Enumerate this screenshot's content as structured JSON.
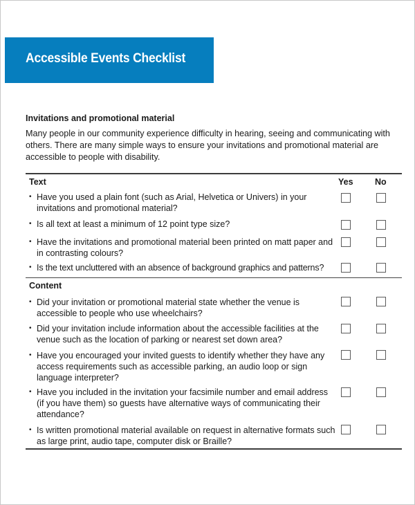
{
  "banner": {
    "title": "Accessible Events Checklist",
    "color": "#067ebe"
  },
  "section": {
    "heading": "Invitations and promotional material",
    "intro": "Many people in our community experience difficulty in hearing, seeing and communicating with others.  There are many simple ways to ensure your invitations and promotional material are accessible to people with disability."
  },
  "table": {
    "columns": {
      "yes": "Yes",
      "no": "No"
    },
    "bullet": "•",
    "groups": [
      {
        "title": "Text",
        "items": [
          {
            "text": "Have you used a plain font (such as Arial, Helvetica or Univers) in your invitations and promotional material?",
            "yes": false,
            "no": false
          },
          {
            "text": "Is all text at least a minimum of 12 point type size?",
            "yes": false,
            "no": false
          },
          {
            "text": "Have the invitations and promotional material been printed on matt paper and in contrasting colours?",
            "yes": false,
            "no": false
          },
          {
            "text": "Is the text uncluttered with an absence of background graphics and patterns?",
            "yes": false,
            "no": false
          }
        ]
      },
      {
        "title": "Content",
        "items": [
          {
            "text": "Did your invitation or promotional material state whether the venue is accessible to people who use wheelchairs?",
            "yes": false,
            "no": false
          },
          {
            "text": "Did your invitation include information about the accessible facilities at the venue such as the location of parking or nearest set down area?",
            "yes": false,
            "no": false
          },
          {
            "text": "Have you encouraged your invited guests to identify whether they have any access requirements such as accessible parking, an audio loop or sign language interpreter?",
            "yes": false,
            "no": false
          },
          {
            "text": "Have you included in the invitation your facsimile number and email address (if you have them) so guests have alternative ways of communicating their attendance?",
            "yes": false,
            "no": false
          },
          {
            "text": "Is written promotional material available on request in alternative formats such as large print, audio tape, computer disk or Braille?",
            "yes": false,
            "no": false
          }
        ]
      }
    ]
  }
}
